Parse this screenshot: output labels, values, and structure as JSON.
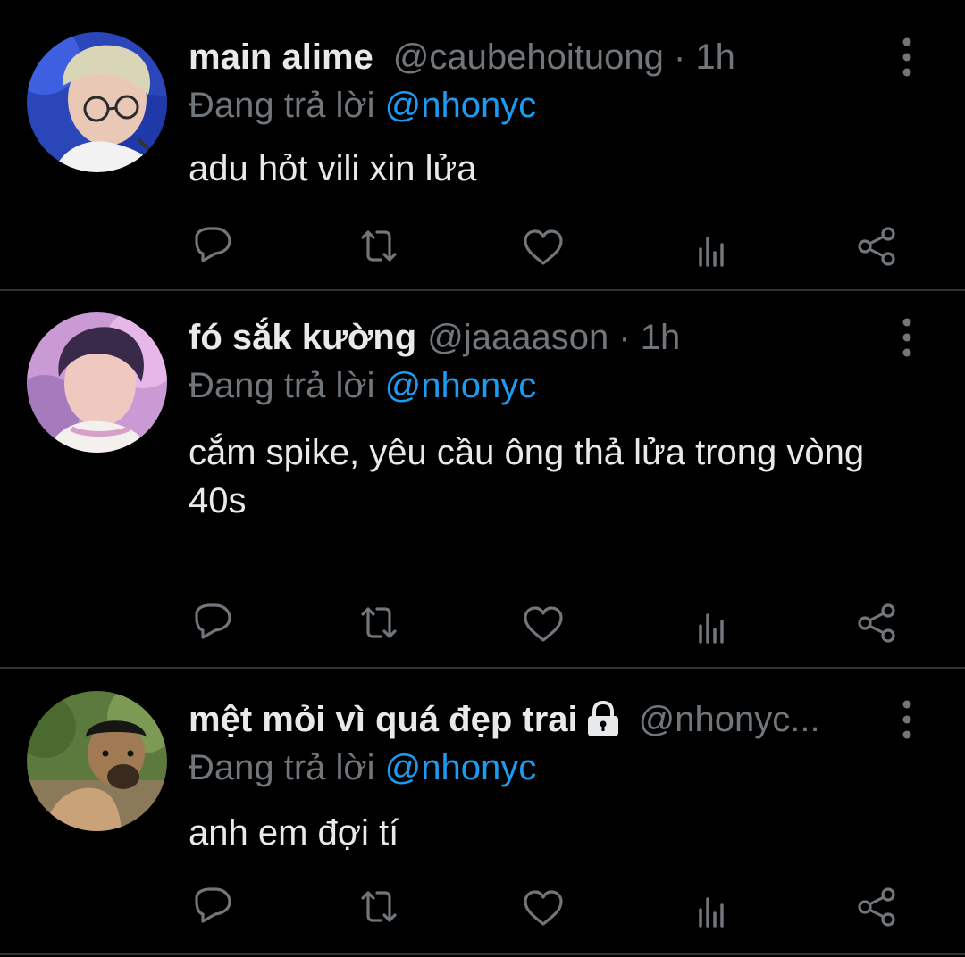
{
  "tweets": [
    {
      "display_name": "main alime",
      "handle_meta": "@caubehoituong · 1h",
      "reply_prefix": "Đang trả lời ",
      "reply_mention": "@nhonyc",
      "text": "adu hỏt vili xin lửa"
    },
    {
      "display_name": "fó sắk kường",
      "handle_meta": "@jaaaason · 1h",
      "reply_prefix": "Đang trả lời ",
      "reply_mention": "@nhonyc",
      "text": "cắm spike, yêu cầu ông thả lửa trong vòng 40s"
    },
    {
      "display_name": "mệt mỏi vì quá đẹp trai",
      "handle_meta": "@nhonyc...",
      "reply_prefix": "Đang trả lời ",
      "reply_mention": "@nhonyc",
      "text": "anh em đợi tí",
      "protected": true
    }
  ],
  "actions": [
    "reply-icon",
    "retweet-icon",
    "like-icon",
    "analytics-icon",
    "share-icon"
  ],
  "colors": {
    "background": "#000000",
    "text": "#e7e9ea",
    "muted": "#71767b",
    "accent": "#1d9bf0",
    "divider": "#2f3336"
  }
}
